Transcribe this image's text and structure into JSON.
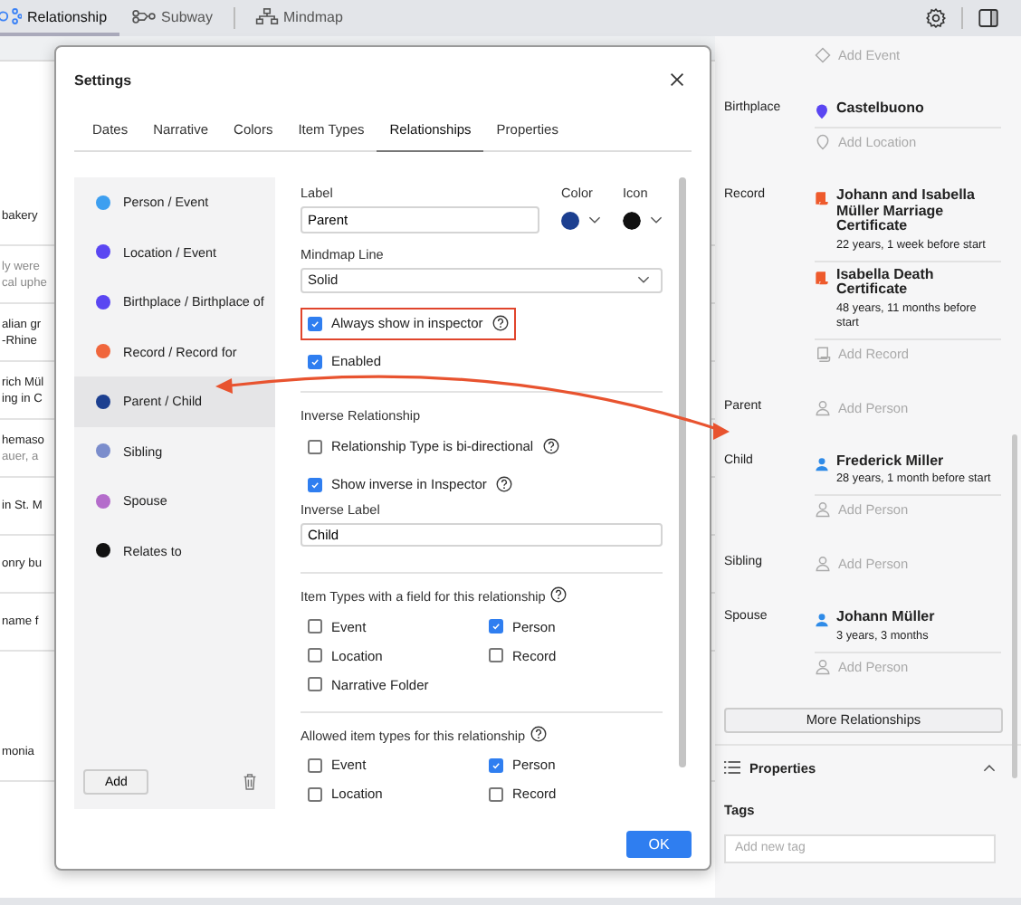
{
  "toolbar": {
    "tabs": [
      {
        "label": "Relationship",
        "selected": true,
        "kind": "relationship"
      },
      {
        "label": "Subway",
        "selected": false,
        "kind": "subway"
      },
      {
        "label": "Mindmap",
        "selected": false,
        "kind": "mindmap"
      }
    ]
  },
  "background_list": [
    {
      "lines": [
        {
          "text": "bakery",
          "muted": false
        }
      ]
    },
    {
      "lines": [
        {
          "text": "ly were",
          "muted": true
        },
        {
          "text": "cal uphe",
          "muted": true
        }
      ]
    },
    {
      "lines": [
        {
          "text": "alian gr",
          "muted": false
        },
        {
          "text": "-Rhine",
          "muted": false
        }
      ]
    },
    {
      "lines": [
        {
          "text": "rich Mül",
          "muted": false
        },
        {
          "text": "ing in C",
          "muted": false
        }
      ]
    },
    {
      "lines": [
        {
          "text": "hemaso",
          "muted": false
        },
        {
          "text": "auer, a",
          "muted": true
        }
      ]
    },
    {
      "lines": [
        {
          "text": "in St. M",
          "muted": false
        }
      ]
    },
    {
      "lines": [
        {
          "text": "onry bu",
          "muted": false
        }
      ]
    },
    {
      "lines": [
        {
          "text": "name f",
          "muted": false
        }
      ]
    },
    {
      "lines": [
        {
          "text": "monia",
          "muted": false
        }
      ]
    }
  ],
  "inspector": {
    "rows": [
      {
        "label": "",
        "items": [],
        "add": {
          "kind": "event",
          "label": "Add Event"
        }
      },
      {
        "label": "Birthplace",
        "items": [
          {
            "kind": "location",
            "title": "Castelbuono"
          }
        ],
        "add": {
          "kind": "location",
          "label": "Add Location"
        }
      },
      {
        "label": "Record",
        "items": [
          {
            "kind": "record",
            "title": "Johann and Isabella Müller Marriage Certificate",
            "detail": "22 years, 1 week before start"
          },
          {
            "kind": "record",
            "title": "Isabella Death Certificate",
            "detail": "48 years, 11 months before start"
          }
        ],
        "add": {
          "kind": "record",
          "label": "Add Record"
        }
      },
      {
        "label": "Parent",
        "items": [],
        "add": {
          "kind": "person",
          "label": "Add Person"
        }
      },
      {
        "label": "Child",
        "items": [
          {
            "kind": "person",
            "title": "Frederick Miller",
            "detail": "28 years, 1 month before start"
          }
        ],
        "add": {
          "kind": "person",
          "label": "Add Person"
        }
      },
      {
        "label": "Sibling",
        "items": [],
        "add": {
          "kind": "person",
          "label": "Add Person"
        }
      },
      {
        "label": "Spouse",
        "items": [
          {
            "kind": "person",
            "title": "Johann Müller",
            "detail": "3 years, 3 months"
          }
        ],
        "add": {
          "kind": "person",
          "label": "Add Person"
        }
      }
    ],
    "more_button": "More Relationships",
    "properties": {
      "title": "Properties",
      "expanded": true,
      "tags_label": "Tags",
      "tag_placeholder": "Add new tag"
    }
  },
  "dialog": {
    "title": "Settings",
    "tabs": [
      {
        "label": "Dates",
        "selected": false
      },
      {
        "label": "Narrative",
        "selected": false
      },
      {
        "label": "Colors",
        "selected": false
      },
      {
        "label": "Item Types",
        "selected": false
      },
      {
        "label": "Relationships",
        "selected": true
      },
      {
        "label": "Properties",
        "selected": false
      }
    ],
    "relationships": [
      {
        "name": "Person / Event",
        "color": "#3d9ff0",
        "selected": false
      },
      {
        "name": "Location / Event",
        "color": "#5a46f2",
        "selected": false
      },
      {
        "name": "Birthplace / Birthplace of",
        "color": "#5a46f2",
        "selected": false
      },
      {
        "name": "Record / Record for",
        "color": "#f0663c",
        "selected": false
      },
      {
        "name": "Parent / Child",
        "color": "#1c3f90",
        "selected": true
      },
      {
        "name": "Sibling",
        "color": "#7b8dcc",
        "selected": false
      },
      {
        "name": "Spouse",
        "color": "#b46ccb",
        "selected": false
      },
      {
        "name": "Relates to",
        "color": "#111111",
        "selected": false
      }
    ],
    "add_button": "Add",
    "form": {
      "label_caption": "Label",
      "label_value": "Parent",
      "color_caption": "Color",
      "color": "#1c3f90",
      "icon_caption": "Icon",
      "line_caption": "Mindmap Line",
      "line_value": "Solid",
      "options": [
        {
          "label": "Always show in inspector",
          "checked": true,
          "help": true,
          "highlighted": true
        },
        {
          "label": "Enabled",
          "checked": true,
          "help": false,
          "highlighted": false
        }
      ],
      "inverse_heading": "Inverse Relationship",
      "inverse_options": [
        {
          "label": "Relationship Type is bi-directional",
          "checked": false,
          "help": true,
          "highlighted": false
        },
        {
          "label": "Show inverse in Inspector",
          "checked": true,
          "help": true,
          "highlighted": false
        }
      ],
      "inverse_label_caption": "Inverse Label",
      "inverse_label_value": "Child",
      "field_types_heading": "Item Types with a field for this relationship",
      "field_types": [
        {
          "label": "Event",
          "checked": false
        },
        {
          "label": "Person",
          "checked": true
        },
        {
          "label": "Location",
          "checked": false
        },
        {
          "label": "Record",
          "checked": false
        },
        {
          "label": "Narrative Folder",
          "checked": false
        }
      ],
      "allowed_heading": "Allowed item types for this relationship",
      "allowed_types": [
        {
          "label": "Event",
          "checked": false
        },
        {
          "label": "Person",
          "checked": true
        },
        {
          "label": "Location",
          "checked": false
        },
        {
          "label": "Record",
          "checked": false
        }
      ]
    },
    "ok_button": "OK"
  }
}
